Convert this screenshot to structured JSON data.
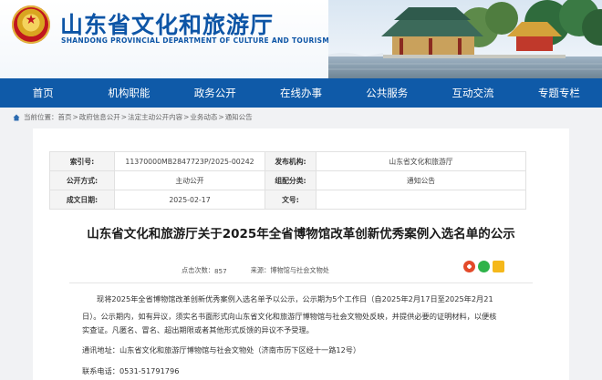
{
  "site": {
    "title": "山东省文化和旅游厅",
    "subtitle": "SHANDONG PROVINCIAL DEPARTMENT OF CULTURE AND TOURISM"
  },
  "nav": [
    "首页",
    "机构职能",
    "政务公开",
    "在线办事",
    "公共服务",
    "互动交流",
    "专题专栏"
  ],
  "breadcrumb": {
    "items": [
      "当前位置：",
      "首页",
      ">",
      "政府信息公开",
      ">",
      "法定主动公开内容",
      ">",
      "业务动态",
      ">",
      "通知公告"
    ]
  },
  "meta": {
    "index_label": "索引号:",
    "index_value": "11370000MB2847723P/2025-00242",
    "publisher_label": "发布机构:",
    "publisher_value": "山东省文化和旅游厅",
    "mode_label": "公开方式:",
    "mode_value": "主动公开",
    "category_label": "组配分类:",
    "category_value": "通知公告",
    "date_label": "成文日期:",
    "date_value": "2025-02-17",
    "docno_label": "文号:",
    "docno_value": ""
  },
  "article": {
    "title": "山东省文化和旅游厅关于2025年全省博物馆改革创新优秀案例入选名单的公示",
    "clicks_label": "点击次数：",
    "clicks_value": "857",
    "source_label": "来源：",
    "source_value": "博物馆与社会文物处",
    "p1": "现将2025年全省博物馆改革创新优秀案例入选名单予以公示，公示期为5个工作日（自2025年2月17日至2025年2月21",
    "p1b": "日）。公示期内，如有异议，须实名书面形式向山东省文化和旅游厅博物馆与社会文物处反映，并提供必要的证明材料，以便核",
    "p1c": "实查证。凡匿名、冒名、超出期限或者其他形式反馈的异议不予受理。",
    "address": "通讯地址：山东省文化和旅游厅博物馆与社会文物处（济南市历下区经十一路12号）",
    "phone": "联系电话：0531-51791796"
  },
  "colors": {
    "brand": "#0f5aa8",
    "title": "#0d55a6"
  }
}
